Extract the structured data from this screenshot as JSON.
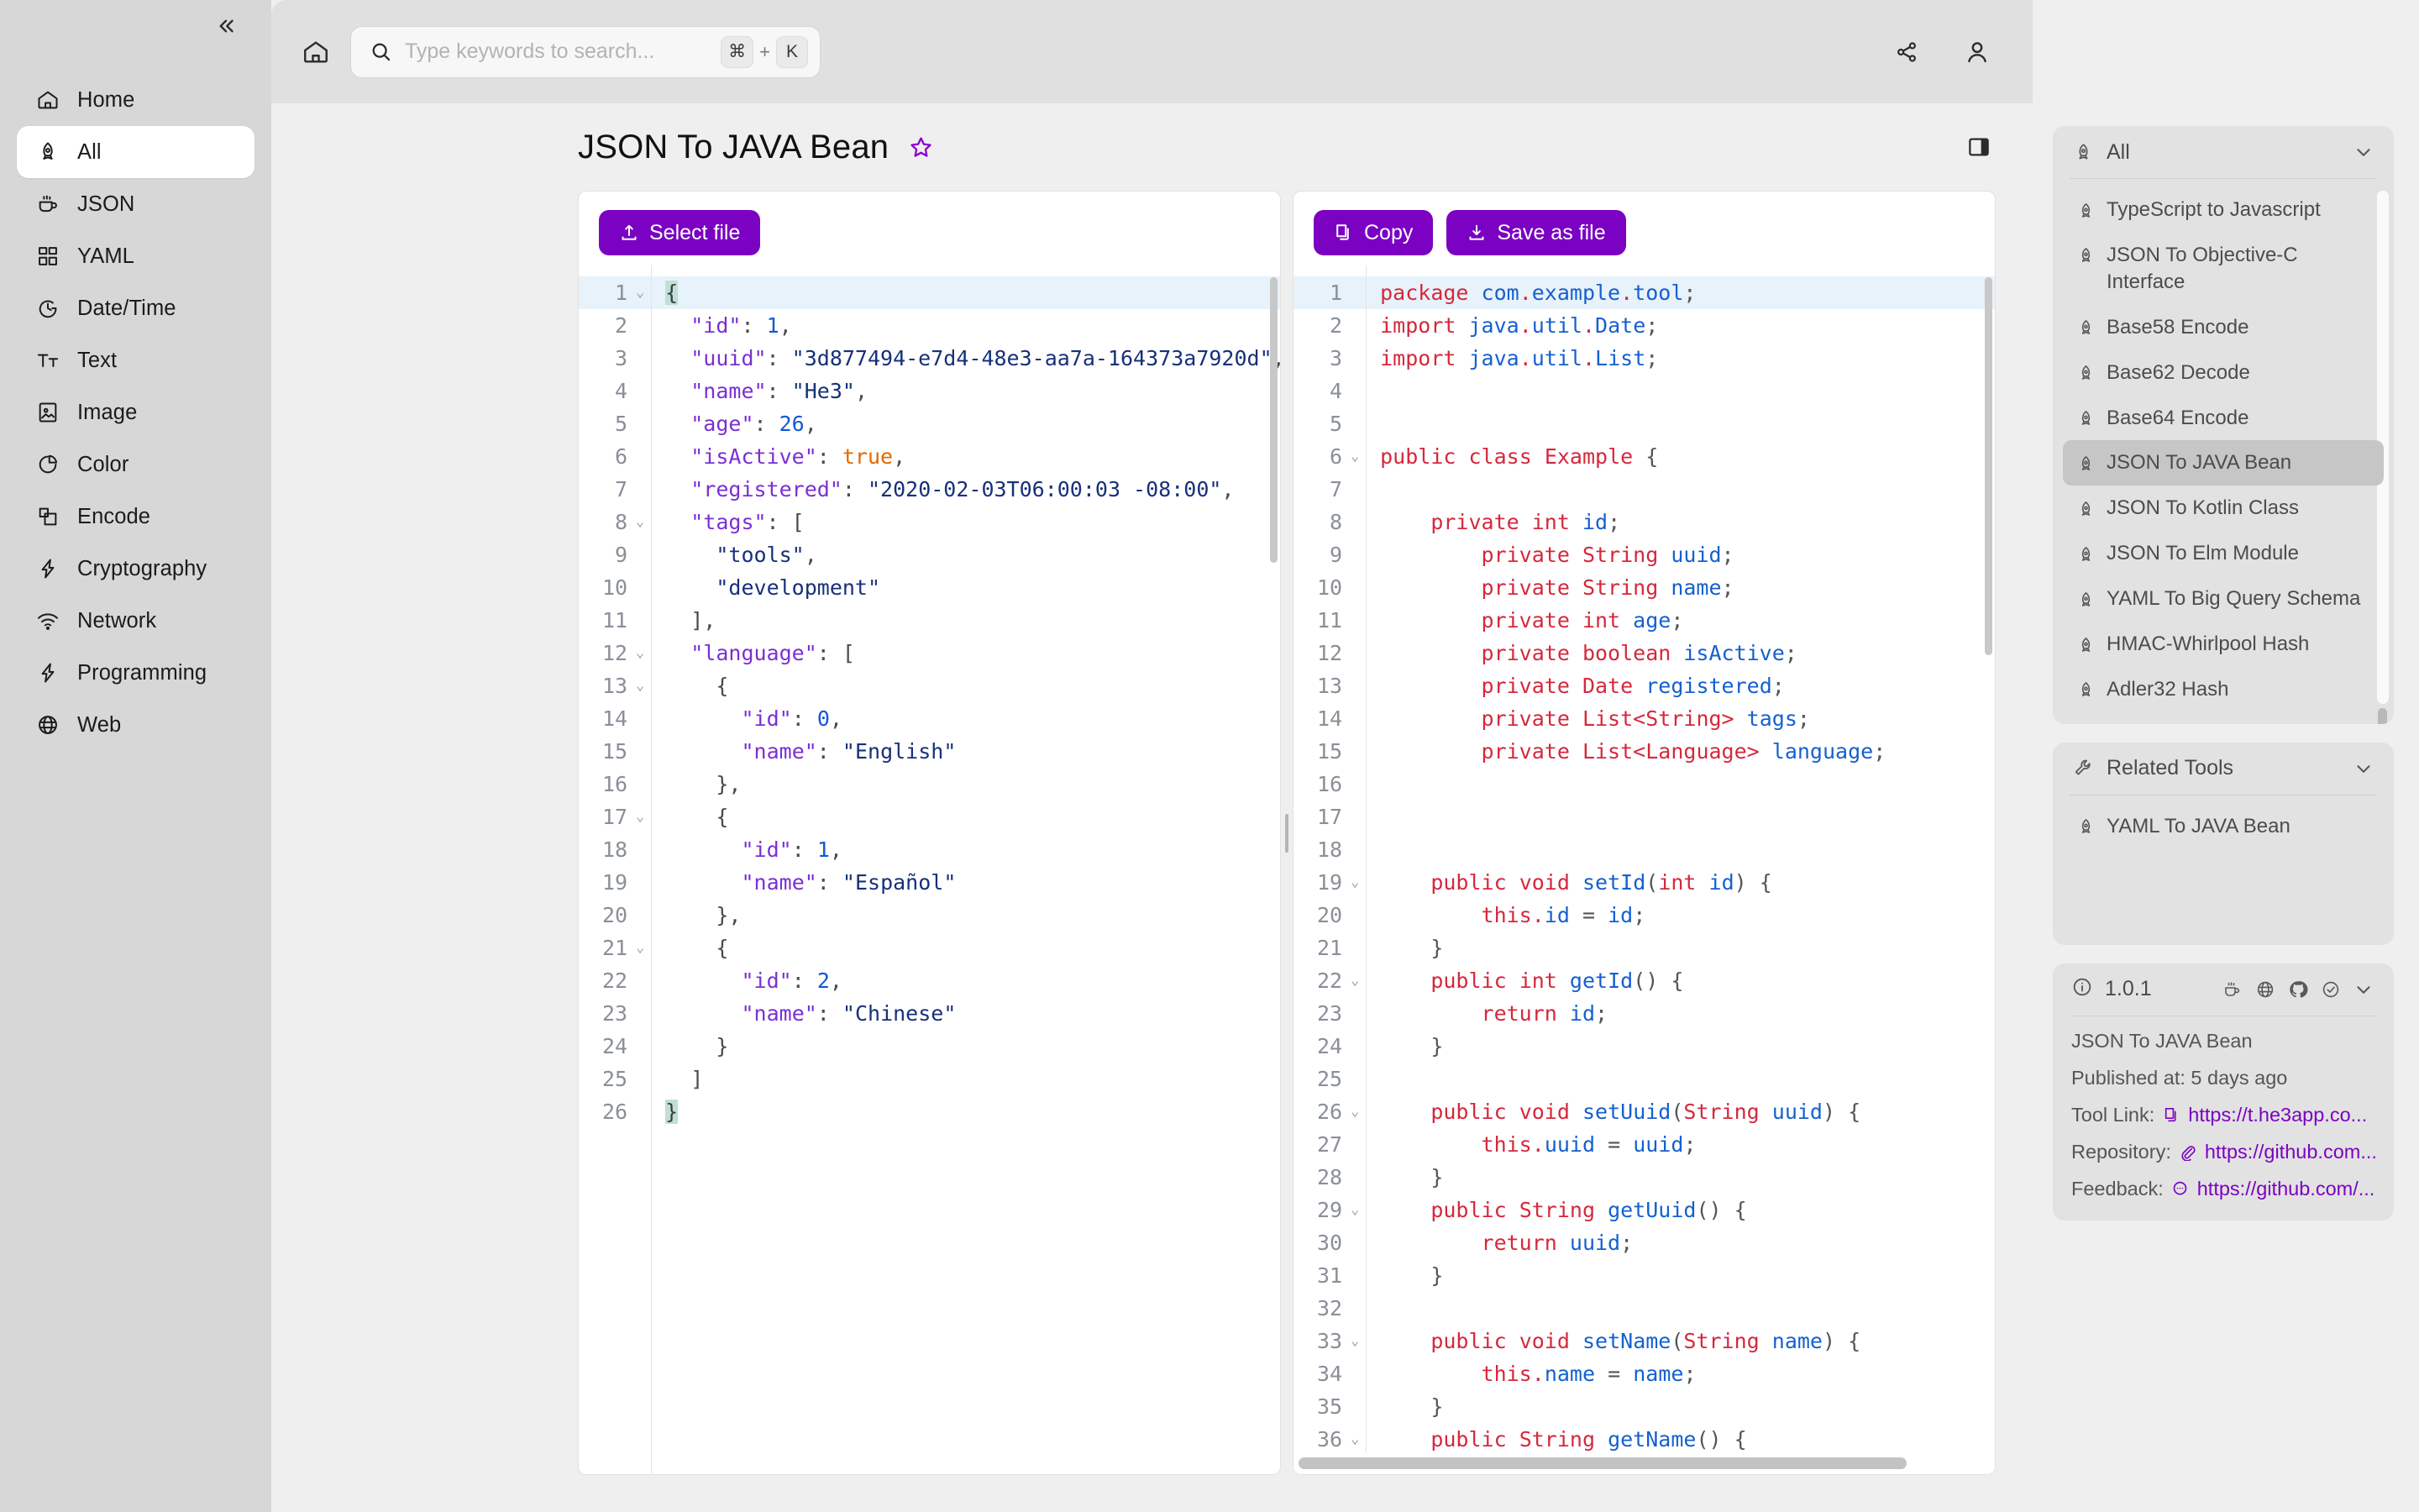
{
  "sidebar": {
    "collapse_icon": "chevrons-left-icon",
    "items": [
      {
        "label": "Home",
        "icon": "home-icon",
        "active": false
      },
      {
        "label": "All",
        "icon": "rocket-icon",
        "active": true
      },
      {
        "label": "JSON",
        "icon": "coffee-icon",
        "active": false
      },
      {
        "label": "YAML",
        "icon": "grid-icon",
        "active": false
      },
      {
        "label": "Date/Time",
        "icon": "clock-icon",
        "active": false
      },
      {
        "label": "Text",
        "icon": "text-icon",
        "active": false
      },
      {
        "label": "Image",
        "icon": "image-icon",
        "active": false
      },
      {
        "label": "Color",
        "icon": "pie-chart-icon",
        "active": false
      },
      {
        "label": "Encode",
        "icon": "layers-icon",
        "active": false
      },
      {
        "label": "Cryptography",
        "icon": "bolt-icon",
        "active": false
      },
      {
        "label": "Network",
        "icon": "wifi-icon",
        "active": false
      },
      {
        "label": "Programming",
        "icon": "bolt-icon",
        "active": false
      },
      {
        "label": "Web",
        "icon": "globe-icon",
        "active": false
      }
    ]
  },
  "topbar": {
    "home_icon": "home-icon",
    "search": {
      "placeholder": "Type keywords to search...",
      "value": "",
      "icon": "search-icon"
    },
    "shortcut": {
      "modifier": "⌘",
      "plus": "+",
      "key": "K"
    },
    "share_icon": "share-icon",
    "account_icon": "user-icon"
  },
  "page": {
    "title": "JSON To JAVA Bean",
    "favorite_icon": "star-outline-icon",
    "panel_toggle_icon": "right-panel-icon"
  },
  "input_panel": {
    "select_file_label": "Select file",
    "select_file_icon": "upload-icon",
    "total_lines": 26,
    "highlight_line": 1,
    "fold_lines": [
      1,
      8,
      12,
      13,
      17,
      21
    ],
    "lines": [
      "{",
      "  \"id\": 1,",
      "  \"uuid\": \"3d877494-e7d4-48e3-aa7a-164373a7920d\",",
      "  \"name\": \"He3\",",
      "  \"age\": 26,",
      "  \"isActive\": true,",
      "  \"registered\": \"2020-02-03T06:00:03 -08:00\",",
      "  \"tags\": [",
      "    \"tools\",",
      "    \"development\"",
      "  ],",
      "  \"language\": [",
      "    {",
      "      \"id\": 0,",
      "      \"name\": \"English\"",
      "    },",
      "    {",
      "      \"id\": 1,",
      "      \"name\": \"Español\"",
      "    },",
      "    {",
      "      \"id\": 2,",
      "      \"name\": \"Chinese\"",
      "    }",
      "  ]",
      "}"
    ]
  },
  "output_panel": {
    "copy_label": "Copy",
    "copy_icon": "copy-icon",
    "save_label": "Save as file",
    "save_icon": "download-icon",
    "total_lines": 36,
    "highlight_line": 1,
    "fold_lines": [
      6,
      19,
      22,
      26,
      29,
      33,
      36
    ],
    "lines": [
      "package com.example.tool;",
      "import java.util.Date;",
      "import java.util.List;",
      "",
      "",
      "public class Example {",
      "",
      "    private int id;",
      "        private String uuid;",
      "        private String name;",
      "        private int age;",
      "        private boolean isActive;",
      "        private Date registered;",
      "        private List<String> tags;",
      "        private List<Language> language;",
      "",
      "",
      "",
      "    public void setId(int id) {",
      "        this.id = id;",
      "    }",
      "    public int getId() {",
      "        return id;",
      "    }",
      "",
      "    public void setUuid(String uuid) {",
      "        this.uuid = uuid;",
      "    }",
      "    public String getUuid() {",
      "        return uuid;",
      "    }",
      "",
      "    public void setName(String name) {",
      "        this.name = name;",
      "    }",
      "    public String getName() {"
    ]
  },
  "rail": {
    "tools_panel": {
      "title": "All",
      "icon": "rocket-icon",
      "chevron_icon": "chevron-down-icon",
      "items": [
        {
          "label": "TypeScript to Javascript",
          "active": false
        },
        {
          "label": "JSON To Objective-C Interface",
          "active": false
        },
        {
          "label": "Base58 Encode",
          "active": false
        },
        {
          "label": "Base62 Decode",
          "active": false
        },
        {
          "label": "Base64 Encode",
          "active": false
        },
        {
          "label": "JSON To JAVA Bean",
          "active": true
        },
        {
          "label": "JSON To Kotlin Class",
          "active": false
        },
        {
          "label": "JSON To Elm Module",
          "active": false
        },
        {
          "label": "YAML To Big Query Schema",
          "active": false
        },
        {
          "label": "HMAC-Whirlpool Hash",
          "active": false
        },
        {
          "label": "Adler32 Hash",
          "active": false
        }
      ]
    },
    "related_panel": {
      "title": "Related Tools",
      "icon": "wrench-icon",
      "chevron_icon": "chevron-down-icon",
      "items": [
        {
          "label": "YAML To JAVA Bean",
          "active": false
        }
      ]
    },
    "info_panel": {
      "version": "1.0.1",
      "info_icon": "info-circle-icon",
      "header_icons": [
        "coffee-icon",
        "globe-icon",
        "github-icon",
        "check-circle-icon",
        "chevron-down-icon"
      ],
      "tool_name": "JSON To JAVA Bean",
      "published_label": "Published at: 5 days ago",
      "tool_link_label": "Tool Link:",
      "tool_link_icon": "copy-icon",
      "tool_link_value": "https://t.he3app.co...",
      "repository_label": "Repository:",
      "repository_icon": "paperclip-icon",
      "repository_value": "https://github.com...",
      "feedback_label": "Feedback:",
      "feedback_icon": "message-icon",
      "feedback_value": "https://github.com/..."
    }
  },
  "colors": {
    "accent": "#7b02c2",
    "sidebar_bg": "#d7d7d7",
    "panel_bg": "#e2e2e2",
    "active_row": "#c6c6c6",
    "code_highlight": "#e8f2fb"
  }
}
